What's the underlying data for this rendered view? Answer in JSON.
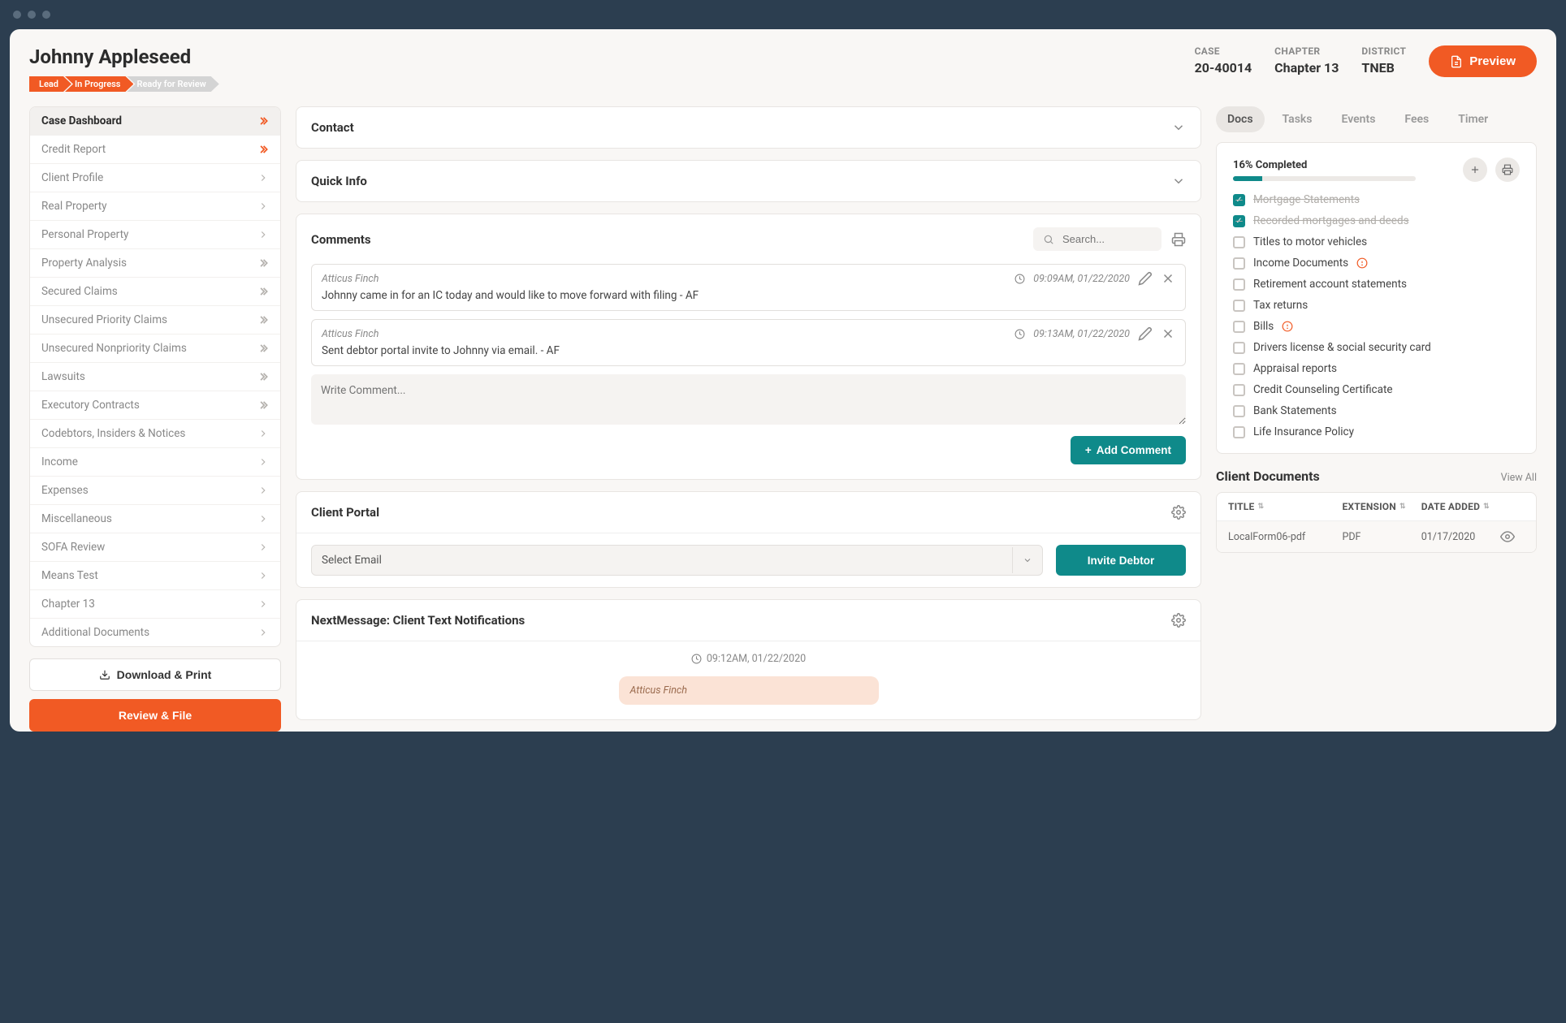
{
  "header": {
    "title": "Johnny Appleseed",
    "status": [
      {
        "label": "Lead",
        "style": "orange"
      },
      {
        "label": "In Progress",
        "style": "orange"
      },
      {
        "label": "Ready for Review",
        "style": "grey"
      }
    ],
    "meta": {
      "case_label": "CASE",
      "case_value": "20-40014",
      "chapter_label": "CHAPTER",
      "chapter_value": "Chapter 13",
      "district_label": "DISTRICT",
      "district_value": "TNEB"
    },
    "preview_btn": "Preview"
  },
  "sidebar": {
    "items": [
      {
        "label": "Case Dashboard",
        "icon": "double-orange",
        "active": true
      },
      {
        "label": "Credit Report",
        "icon": "double-orange"
      },
      {
        "label": "Client Profile",
        "icon": "single"
      },
      {
        "label": "Real Property",
        "icon": "single"
      },
      {
        "label": "Personal Property",
        "icon": "single"
      },
      {
        "label": "Property Analysis",
        "icon": "double"
      },
      {
        "label": "Secured Claims",
        "icon": "double"
      },
      {
        "label": "Unsecured Priority Claims",
        "icon": "double"
      },
      {
        "label": "Unsecured Nonpriority Claims",
        "icon": "double"
      },
      {
        "label": "Lawsuits",
        "icon": "double"
      },
      {
        "label": "Executory Contracts",
        "icon": "double"
      },
      {
        "label": "Codebtors, Insiders & Notices",
        "icon": "single"
      },
      {
        "label": "Income",
        "icon": "single"
      },
      {
        "label": "Expenses",
        "icon": "single"
      },
      {
        "label": "Miscellaneous",
        "icon": "single"
      },
      {
        "label": "SOFA Review",
        "icon": "single"
      },
      {
        "label": "Means Test",
        "icon": "single"
      },
      {
        "label": "Chapter 13",
        "icon": "single"
      },
      {
        "label": "Additional Documents",
        "icon": "single"
      }
    ],
    "download_btn": "Download & Print",
    "review_btn": "Review & File"
  },
  "center": {
    "contact_title": "Contact",
    "quickinfo_title": "Quick Info",
    "comments": {
      "title": "Comments",
      "search_placeholder": "Search...",
      "items": [
        {
          "author": "Atticus Finch",
          "time": "09:09AM, 01/22/2020",
          "text": "Johnny came in for an IC today and would like to move forward with filing - AF"
        },
        {
          "author": "Atticus Finch",
          "time": "09:13AM, 01/22/2020",
          "text": "Sent debtor portal invite to Johnny via email. - AF"
        }
      ],
      "write_placeholder": "Write Comment...",
      "add_btn": "Add Comment"
    },
    "client_portal": {
      "title": "Client Portal",
      "select_label": "Select Email",
      "invite_btn": "Invite Debtor"
    },
    "notifications": {
      "title": "NextMessage: Client Text Notifications",
      "time": "09:12AM, 01/22/2020",
      "bubble_author": "Atticus Finch"
    }
  },
  "right": {
    "tabs": [
      "Docs",
      "Tasks",
      "Events",
      "Fees",
      "Timer"
    ],
    "active_tab": 0,
    "docs": {
      "completed_label": "16% Completed",
      "progress_percent": 16,
      "items": [
        {
          "label": "Mortgage Statements",
          "done": true
        },
        {
          "label": "Recorded mortgages and deeds",
          "done": true
        },
        {
          "label": "Titles to motor vehicles",
          "done": false
        },
        {
          "label": "Income Documents",
          "done": false,
          "warn": true
        },
        {
          "label": "Retirement account statements",
          "done": false
        },
        {
          "label": "Tax returns",
          "done": false
        },
        {
          "label": "Bills",
          "done": false,
          "warn": true
        },
        {
          "label": "Drivers license & social security card",
          "done": false
        },
        {
          "label": "Appraisal reports",
          "done": false
        },
        {
          "label": "Credit Counseling Certificate",
          "done": false
        },
        {
          "label": "Bank Statements",
          "done": false
        },
        {
          "label": "Life Insurance Policy",
          "done": false
        }
      ]
    },
    "client_documents": {
      "title": "Client Documents",
      "view_all": "View All",
      "columns": {
        "title": "TITLE",
        "ext": "EXTENSION",
        "date": "DATE ADDED"
      },
      "rows": [
        {
          "title": "LocalForm06-pdf",
          "ext": "PDF",
          "date": "01/17/2020"
        }
      ]
    }
  }
}
